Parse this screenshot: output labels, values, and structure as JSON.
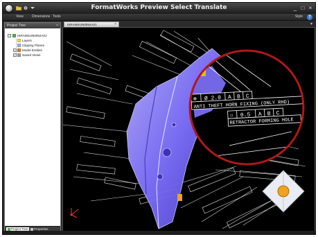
{
  "app": {
    "title": "FormatWorks Preview Select Translate"
  },
  "menu": {
    "items": [
      "View",
      "Dimensions",
      "Tools"
    ],
    "style_label": "Style",
    "help_icon": "?"
  },
  "project_tree": {
    "header": "Project Tree",
    "close_glyph": "×",
    "root": "ISRAMSUN0054A01",
    "children": [
      "Layers",
      "Clipping Planes",
      "Model Entities",
      "Saved Views"
    ],
    "tabs": [
      "Project Tree",
      "Properties"
    ]
  },
  "document": {
    "tab_label": "ISRAMSUN0054A01",
    "tab_close": "×",
    "pin_glyph": "▾"
  },
  "callouts": {
    "fcf1": [
      "⊕",
      "Ø 2.0",
      "A",
      "B",
      "C"
    ],
    "note1": "ANTI THEFT HORN FIXING (ONLY RHD)",
    "fcf2": [
      "○",
      "0.5",
      "A",
      "B",
      "C"
    ],
    "note2": "RETRACTOR FORMING HOLE"
  },
  "colors": {
    "part": "#7f72ff",
    "part_dark": "#4a3fd0",
    "magnifier_ring": "#b01818",
    "nav_arrow": "#e9ecf2",
    "nav_center": "#f2a21b",
    "drawing_lines": "#ffffff"
  },
  "icons": {
    "app_menu": "app-orb-icon",
    "navigation": "navigation-arrows-icon",
    "axis": "axis-triad-icon"
  }
}
